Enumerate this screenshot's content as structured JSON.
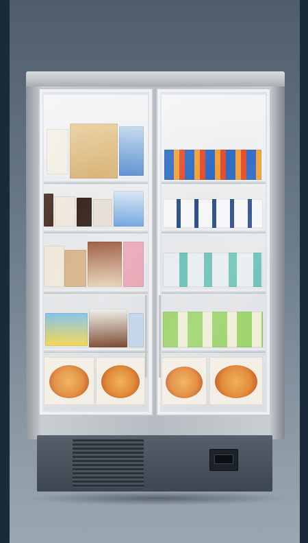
{
  "scene": {
    "subject": "freezer-cabinet",
    "doors": [
      {
        "name": "left-door",
        "shelves": 5
      },
      {
        "name": "right-door",
        "shelves": 5
      }
    ]
  },
  "colors": {
    "backdrop_top": "#4f5d6c",
    "backdrop_bottom": "#9aa6b1",
    "frame": "#b6bcc1",
    "plinth": "#3c4650"
  }
}
